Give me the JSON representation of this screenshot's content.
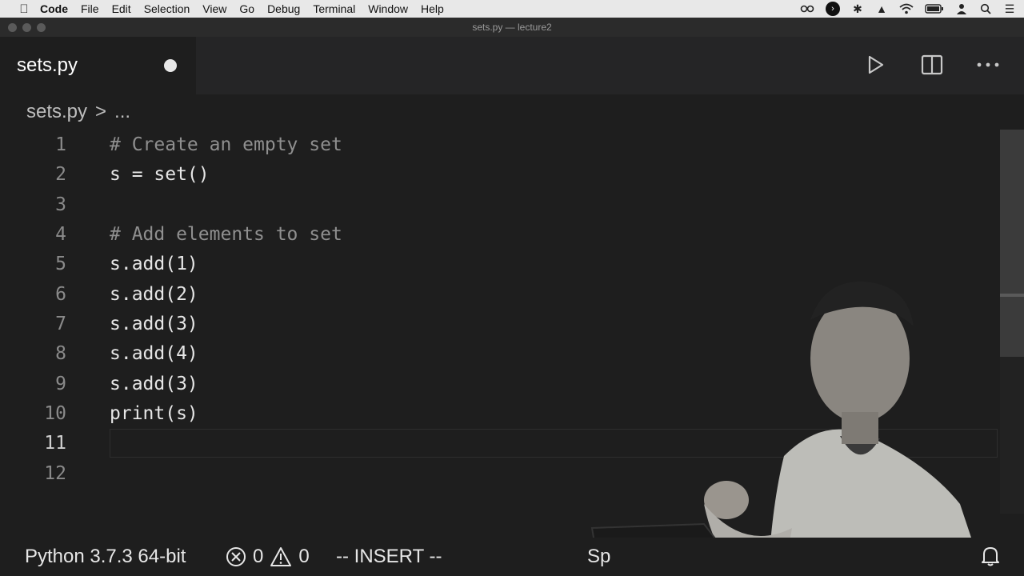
{
  "menubar": {
    "app_name": "Code",
    "items": [
      "File",
      "Edit",
      "Selection",
      "View",
      "Go",
      "Debug",
      "Terminal",
      "Window",
      "Help"
    ]
  },
  "window": {
    "title": "sets.py — lecture2"
  },
  "tab": {
    "label": "sets.py"
  },
  "breadcrumb": {
    "file": "sets.py",
    "separator": ">",
    "more": "..."
  },
  "editor": {
    "lines": [
      {
        "num": "1",
        "text": "# Create an empty set",
        "comment": true
      },
      {
        "num": "2",
        "text": "s = set()",
        "comment": false
      },
      {
        "num": "3",
        "text": "",
        "comment": false
      },
      {
        "num": "4",
        "text": "# Add elements to set",
        "comment": true
      },
      {
        "num": "5",
        "text": "s.add(1)",
        "comment": false
      },
      {
        "num": "6",
        "text": "s.add(2)",
        "comment": false
      },
      {
        "num": "7",
        "text": "s.add(3)",
        "comment": false
      },
      {
        "num": "8",
        "text": "s.add(4)",
        "comment": false
      },
      {
        "num": "9",
        "text": "s.add(3)",
        "comment": false
      },
      {
        "num": "10",
        "text": "print(s)",
        "comment": false
      },
      {
        "num": "11",
        "text": "",
        "comment": false
      },
      {
        "num": "12",
        "text": "",
        "comment": false
      }
    ]
  },
  "statusbar": {
    "interpreter": "Python 3.7.3 64-bit",
    "errors": "0",
    "warnings": "0",
    "mode": "-- INSERT --",
    "spaces_partial": "Sp"
  },
  "icons": [
    "apple-icon",
    "run-icon",
    "split-editor-icon",
    "more-actions-icon",
    "error-icon",
    "warning-icon",
    "bell-icon"
  ]
}
